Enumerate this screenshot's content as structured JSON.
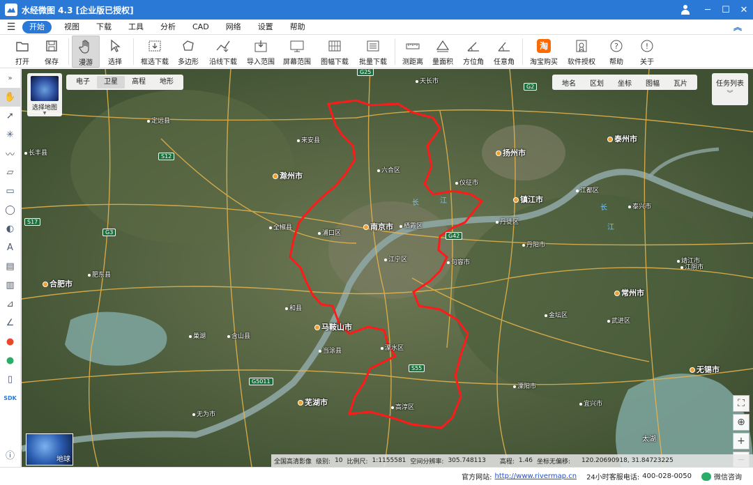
{
  "titlebar": {
    "title": "水经微图 4.3 [企业版已授权]"
  },
  "menubar": {
    "items": [
      "开始",
      "视图",
      "下载",
      "工具",
      "分析",
      "CAD",
      "网络",
      "设置",
      "帮助"
    ]
  },
  "toolbar": {
    "items": [
      {
        "label": "打开",
        "icon": "folder-icon"
      },
      {
        "label": "保存",
        "icon": "save-icon"
      },
      {
        "label": "漫游",
        "icon": "hand-icon"
      },
      {
        "label": "选择",
        "icon": "cursor-icon"
      },
      {
        "label": "框选下载",
        "icon": "box-download-icon"
      },
      {
        "label": "多边形",
        "icon": "polygon-icon"
      },
      {
        "label": "沿线下载",
        "icon": "line-download-icon"
      },
      {
        "label": "导入范围",
        "icon": "import-icon"
      },
      {
        "label": "屏幕范围",
        "icon": "screen-icon"
      },
      {
        "label": "图幅下载",
        "icon": "grid-download-icon"
      },
      {
        "label": "批量下载",
        "icon": "batch-download-icon"
      },
      {
        "label": "测距离",
        "icon": "ruler-icon"
      },
      {
        "label": "量面积",
        "icon": "area-icon"
      },
      {
        "label": "方位角",
        "icon": "azimuth-icon"
      },
      {
        "label": "任意角",
        "icon": "angle-icon"
      },
      {
        "label": "淘宝购买",
        "icon": "taobao-icon"
      },
      {
        "label": "软件授权",
        "icon": "license-icon"
      },
      {
        "label": "帮助",
        "icon": "help-icon"
      },
      {
        "label": "关于",
        "icon": "info-icon"
      }
    ]
  },
  "map": {
    "maptype": "选择地图",
    "layer_tabs": [
      "电子",
      "卫星",
      "高程",
      "地形"
    ],
    "overlay_tabs": [
      "地名",
      "区划",
      "坐标",
      "图幅",
      "瓦片"
    ],
    "task_list": "任务列表",
    "globe_label": "地球",
    "status": {
      "source": "全国高清影像",
      "level_label": "级别:",
      "level": "10",
      "scale_label": "比例尺:",
      "scale": "1:1155581",
      "resolution_label": "空间分辨率:",
      "resolution": "305.748113",
      "elev_label": "高程:",
      "elev": "1.46",
      "offset_label": "坐标无偏移:",
      "coords": "120.20690918, 31.84723225"
    },
    "labels": {
      "nanjing": "南京市",
      "yangzhou": "扬州市",
      "zhenjiang": "镇江市",
      "taizhou": "泰州市",
      "changzhou": "常州市",
      "wuxi": "无锡市",
      "hefei": "合肥市",
      "chuzhou": "滁州市",
      "maanshan": "马鞍山市",
      "wuhu": "芜湖市",
      "tianchang": "天长市",
      "quanjiao": "全椒县",
      "lishui": "溧水区",
      "gaochun": "高淳区",
      "luhe": "六合区",
      "pukou": "浦口区",
      "qixia": "栖霞区",
      "jiangning": "江宁区",
      "jurong": "句容市",
      "dantu": "丹徒区",
      "danyang": "丹阳市",
      "yizheng": "仪征市",
      "hexian": "和县",
      "liyang": "溧阳市",
      "jintan": "金坛区",
      "yixing": "宜兴市",
      "changfeng": "长丰县",
      "feidong": "肥东县",
      "jiangdu": "江都区",
      "taixing": "泰兴市",
      "jingjiang": "靖江市",
      "jiangyin": "江阴市",
      "wujin": "武进区",
      "dingyuan": "定远县",
      "laian": "来安县",
      "hanshan": "含山县",
      "dangtu": "当涂县",
      "chaohu": "巢湖",
      "taihu": "太湖",
      "wuwei": "无为市",
      "jiang1": "长",
      "jiang2": "江",
      "jiang3": "长",
      "jiang4": "江"
    },
    "shields": [
      "G25",
      "G2",
      "S12",
      "S17",
      "G3",
      "G42",
      "S55",
      "G5011"
    ]
  },
  "bottombar": {
    "site_label": "官方网站:",
    "site_url": "http://www.rivermap.cn",
    "phone_label": "24小时客服电话:",
    "phone": "400-028-0050",
    "wechat": "微信咨询"
  }
}
